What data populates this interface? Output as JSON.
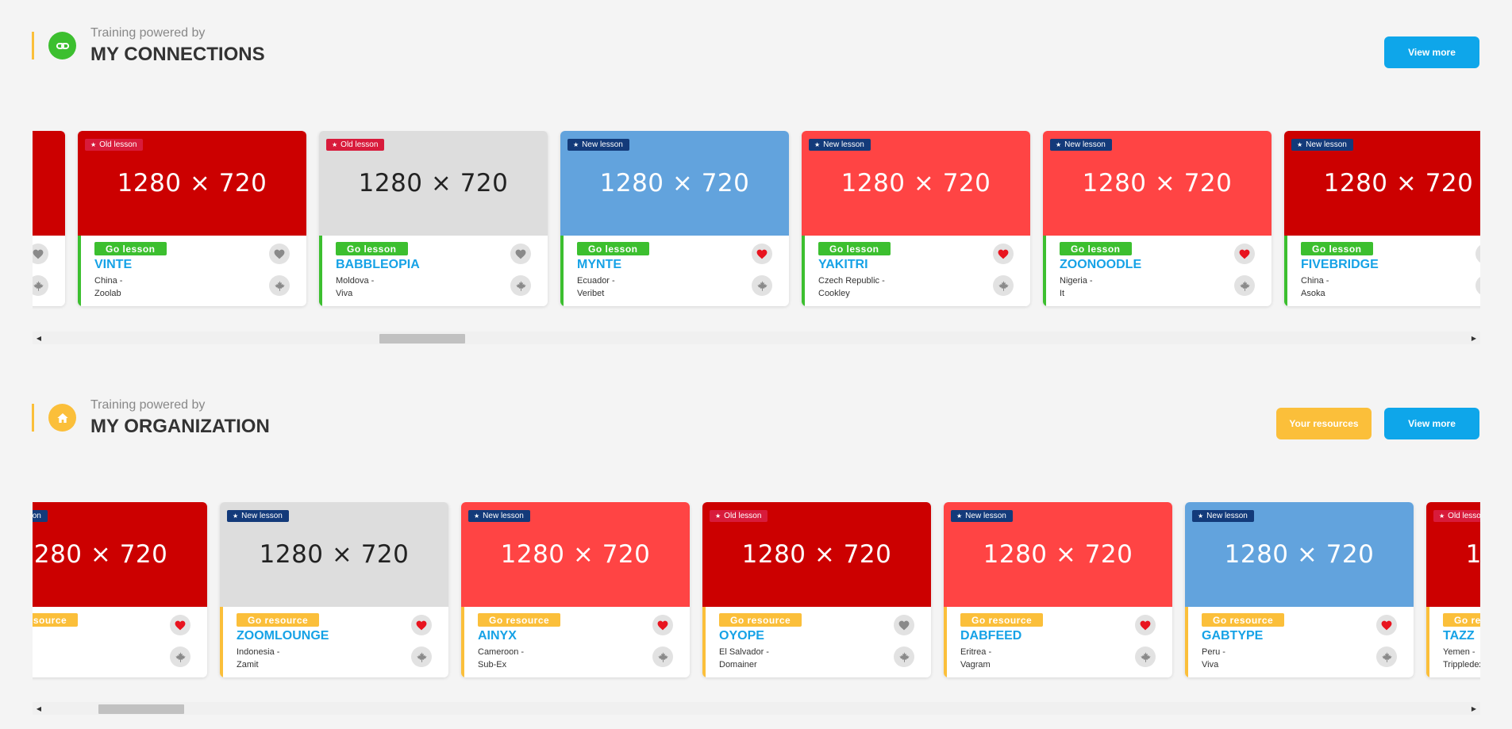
{
  "thumb_label": "1280 × 720",
  "sections": [
    {
      "subtitle": "Training powered by",
      "title": "MY CONNECTIONS",
      "icon": "link-icon",
      "buttons": [
        {
          "label": "View more"
        }
      ],
      "go_label": "Go lesson",
      "scroll_fraction": 0.25,
      "cards": [
        {
          "name": "",
          "country": "",
          "org": "",
          "badge": "",
          "thumb_color": "#cc0000",
          "text_color": "#ffffff",
          "liked": false
        },
        {
          "name": "VINTE",
          "country": "China -",
          "org": "Zoolab",
          "badge": "Old lesson",
          "thumb_color": "#cc0000",
          "text_color": "#ffffff",
          "liked": false
        },
        {
          "name": "BABBLEOPIA",
          "country": "Moldova -",
          "org": "Viva",
          "badge": "Old lesson",
          "thumb_color": "#dddddd",
          "text_color": "#222222",
          "liked": false
        },
        {
          "name": "MYNTE",
          "country": "Ecuador -",
          "org": "Veribet",
          "badge": "New lesson",
          "thumb_color": "#62a3dd",
          "text_color": "#ffffff",
          "liked": true
        },
        {
          "name": "YAKITRI",
          "country": "Czech Republic -",
          "org": "Cookley",
          "badge": "New lesson",
          "thumb_color": "#ff4444",
          "text_color": "#ffffff",
          "liked": true
        },
        {
          "name": "ZOONOODLE",
          "country": "Nigeria -",
          "org": "It",
          "badge": "New lesson",
          "thumb_color": "#ff4444",
          "text_color": "#ffffff",
          "liked": true
        },
        {
          "name": "FIVEBRIDGE",
          "country": "China -",
          "org": "Asoka",
          "badge": "New lesson",
          "thumb_color": "#cc0000",
          "text_color": "#ffffff",
          "liked": true
        }
      ]
    },
    {
      "subtitle": "Training powered by",
      "title": "MY ORGANIZATION",
      "icon": "home-icon",
      "buttons": [
        {
          "label": "Your resources"
        },
        {
          "label": "View more"
        }
      ],
      "go_label": "Go resource",
      "scroll_fraction": 0.04,
      "cards": [
        {
          "name": "",
          "country": "",
          "org": "",
          "badge": "New lesson",
          "thumb_color": "#cc0000",
          "text_color": "#ffffff",
          "liked": true
        },
        {
          "name": "ZOOMLOUNGE",
          "country": "Indonesia -",
          "org": "Zamit",
          "badge": "New lesson",
          "thumb_color": "#dddddd",
          "text_color": "#222222",
          "liked": true
        },
        {
          "name": "AINYX",
          "country": "Cameroon -",
          "org": "Sub-Ex",
          "badge": "New lesson",
          "thumb_color": "#ff4444",
          "text_color": "#ffffff",
          "liked": true
        },
        {
          "name": "OYOPE",
          "country": "El Salvador -",
          "org": "Domainer",
          "badge": "Old lesson",
          "thumb_color": "#cc0000",
          "text_color": "#ffffff",
          "liked": false
        },
        {
          "name": "DABFEED",
          "country": "Eritrea -",
          "org": "Vagram",
          "badge": "New lesson",
          "thumb_color": "#ff4444",
          "text_color": "#ffffff",
          "liked": true
        },
        {
          "name": "GABTYPE",
          "country": "Peru -",
          "org": "Viva",
          "badge": "New lesson",
          "thumb_color": "#62a3dd",
          "text_color": "#ffffff",
          "liked": true
        },
        {
          "name": "TAZZ",
          "country": "Yemen -",
          "org": "Trippledex",
          "badge": "Old lesson",
          "thumb_color": "#cc0000",
          "text_color": "#ffffff",
          "liked": false
        }
      ]
    }
  ],
  "colors": {
    "accent_green": "#3cbf2f",
    "accent_yellow": "#fbbf3a",
    "button_blue": "#0ea6ea",
    "title_blue": "#16a2e6",
    "heart_red": "#e8141f",
    "badge_old": "#d81b3b",
    "badge_new": "#133a7a"
  }
}
